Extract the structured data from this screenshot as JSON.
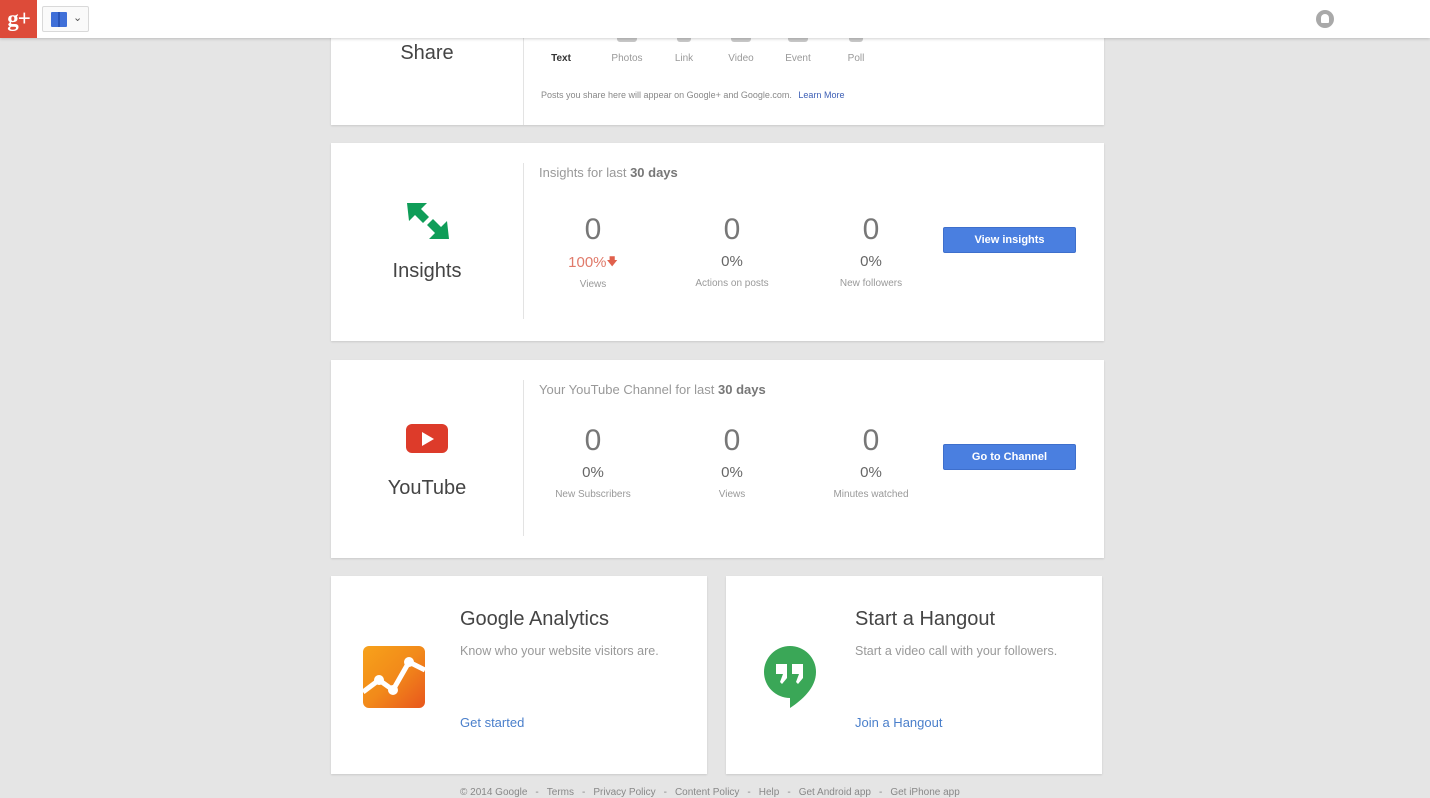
{
  "topbar": {
    "logo_text": "g+",
    "switcher_chevron": "⌄"
  },
  "share": {
    "title": "Share",
    "tabs": [
      {
        "label": "Text",
        "icon": "pencil-icon"
      },
      {
        "label": "Photos",
        "icon": "camera-icon"
      },
      {
        "label": "Link",
        "icon": "link-icon"
      },
      {
        "label": "Video",
        "icon": "video-icon"
      },
      {
        "label": "Event",
        "icon": "calendar-icon"
      },
      {
        "label": "Poll",
        "icon": "poll-icon"
      }
    ],
    "note": "Posts you share here will appear on Google+ and Google.com.",
    "learn_more": "Learn More"
  },
  "insights": {
    "title": "Insights",
    "heading_prefix": "Insights for last",
    "heading_bold": "30 days",
    "stats": [
      {
        "value": "0",
        "pct": "100%",
        "label": "Views"
      },
      {
        "value": "0",
        "pct": "0%",
        "label": "Actions on posts"
      },
      {
        "value": "0",
        "pct": "0%",
        "label": "New followers"
      }
    ],
    "button": "View insights",
    "accent_color": "#0f9d58",
    "down_color": "#e0604c"
  },
  "youtube": {
    "title": "YouTube",
    "heading_prefix": "Your YouTube Channel for last",
    "heading_bold": "30 days",
    "stats": [
      {
        "value": "0",
        "pct": "0%",
        "label": "New Subscribers"
      },
      {
        "value": "0",
        "pct": "0%",
        "label": "Views"
      },
      {
        "value": "0",
        "pct": "0%",
        "label": "Minutes watched"
      }
    ],
    "button": "Go to Channel",
    "accent_color": "#dd3b2a"
  },
  "analytics": {
    "title": "Google Analytics",
    "desc": "Know who your website visitors are.",
    "link": "Get started"
  },
  "hangout": {
    "title": "Start a Hangout",
    "desc": "Start a video call with your followers.",
    "link": "Join a Hangout",
    "accent_color": "#3aa757"
  },
  "footer": {
    "copyright": "© 2014 Google",
    "links": [
      "Terms",
      "Privacy Policy",
      "Content Policy",
      "Help",
      "Get Android app",
      "Get iPhone app"
    ]
  },
  "colors": {
    "brand_red": "#dd4b39",
    "button_blue": "#4a7fe0",
    "link_blue": "#4a7fcb",
    "background": "#e5e5e5"
  }
}
